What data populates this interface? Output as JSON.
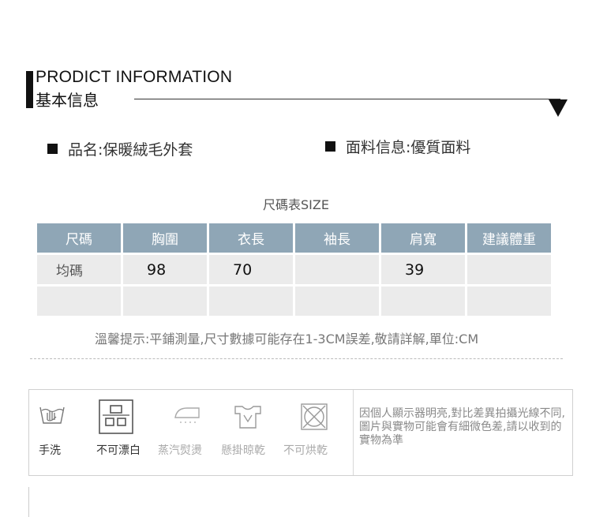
{
  "header": {
    "title_en": "PRODICT INFORMATION",
    "title_zh": "基本信息"
  },
  "info": {
    "product_name": "品名:保暖絨毛外套",
    "fabric": "面料信息:優質面料"
  },
  "size_table": {
    "title": "尺碼表SIZE",
    "columns": [
      "尺碼",
      "胸圍",
      "衣長",
      "袖長",
      "肩寬",
      "建議體重"
    ],
    "rows": [
      [
        "均碼",
        "98",
        "70",
        "",
        "39",
        ""
      ],
      [
        "",
        "",
        "",
        "",
        "",
        ""
      ]
    ]
  },
  "note": "溫馨提示:平鋪測量,尺寸數據可能存在1-3CM誤差,敬請詳解,單位:CM",
  "care": {
    "items": [
      {
        "label": "手洗",
        "icon": "hand-wash-icon",
        "active": true
      },
      {
        "label": "不可漂白",
        "icon": "no-bleach-icon",
        "active": true
      },
      {
        "label": "蒸汽熨燙",
        "icon": "steam-iron-icon",
        "active": false
      },
      {
        "label": "懸掛晾乾",
        "icon": "hang-dry-icon",
        "active": false
      },
      {
        "label": "不可烘乾",
        "icon": "no-tumble-dry-icon",
        "active": false
      }
    ],
    "disclaimer": "因個人顯示器明亮,對比差異拍攝光線不同,圖片與實物可能會有細微色差,請以收到的實物為準"
  },
  "colors": {
    "table_header": "#8fa6b6",
    "table_cell": "#ebebeb"
  }
}
